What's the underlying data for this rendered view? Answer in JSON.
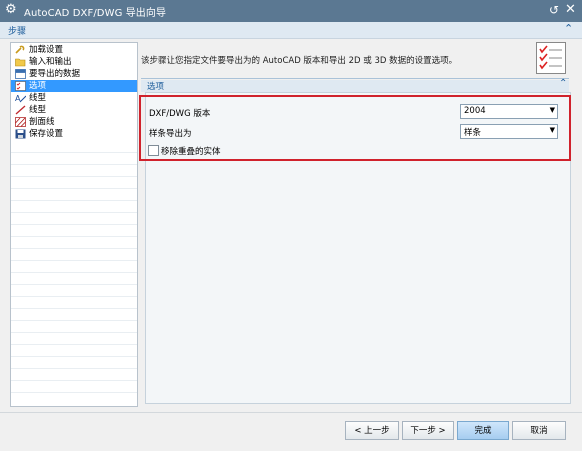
{
  "window": {
    "title": "AutoCAD DXF/DWG 导出向导"
  },
  "steps_section": {
    "label": "步骤",
    "items": [
      {
        "label": "加载设置",
        "icon": "key-wrench-icon",
        "active": false
      },
      {
        "label": "输入和输出",
        "icon": "folder-open-icon",
        "active": false
      },
      {
        "label": "要导出的数据",
        "icon": "table-data-icon",
        "active": false
      },
      {
        "label": "选项",
        "icon": "checklist-icon",
        "active": true
      },
      {
        "label": "线型",
        "icon": "linetype-icon",
        "active": false
      },
      {
        "label": "线型",
        "icon": "line-pen-icon",
        "active": false
      },
      {
        "label": "剖面线",
        "icon": "hatch-icon",
        "active": false
      },
      {
        "label": "保存设置",
        "icon": "save-disk-icon",
        "active": false
      }
    ]
  },
  "main": {
    "description": "该步骤让您指定文件要导出为的 AutoCAD 版本和导出 2D 或 3D 数据的设置选项。",
    "options_header": "选项",
    "fields": {
      "version_label": "DXF/DWG 版本",
      "version_value": "2004",
      "spline_label": "样条导出为",
      "spline_value": "样条",
      "remove_overlap_label": "移除重叠的实体",
      "remove_overlap_checked": false
    }
  },
  "footer": {
    "back": "< 上一步",
    "next": "下一步 >",
    "finish": "完成",
    "cancel": "取消"
  },
  "colors": {
    "titlebar": "#5b7892",
    "accent": "#1d5d9b",
    "selection": "#3399ff",
    "highlight_box": "#d0222c"
  }
}
